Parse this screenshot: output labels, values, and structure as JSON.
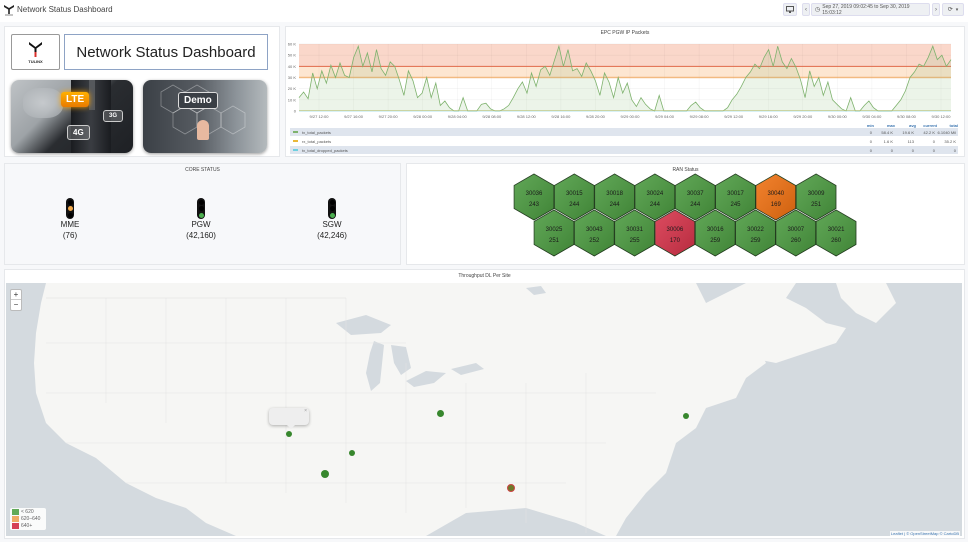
{
  "app": {
    "title": "Network Status Dashboard",
    "logo_icon": "tulinx-logo"
  },
  "toolbar": {
    "tv_mode_icon": "monitor-icon",
    "prev_icon": "chevron-left-icon",
    "time_range": "Sep 27, 2019 09:02:45 to Sep 30, 2019 15:03:12",
    "clock_icon": "clock-icon",
    "next_icon": "chevron-right-icon",
    "refresh_icon": "refresh-icon",
    "dropdown_icon": "caret-down-icon"
  },
  "brand": {
    "logo_text": "TULINX",
    "title": "Network Status Dashboard",
    "promos": [
      {
        "label": "LTE",
        "sublabels": [
          "4G",
          "3G"
        ]
      },
      {
        "label": "Demo"
      }
    ]
  },
  "chart_data": {
    "type": "line",
    "title": "EPC PGW IP Packets",
    "xlabel": "",
    "ylabel": "",
    "ylim": [
      0,
      60000
    ],
    "yticks": [
      "0",
      "10 K",
      "20 K",
      "30 K",
      "40 K",
      "50 K",
      "60 K"
    ],
    "xticks": [
      "9/27 12:00",
      "9/27 16:00",
      "9/27 20:00",
      "9/28 00:00",
      "9/28 04:00",
      "9/28 08:00",
      "9/28 12:00",
      "9/28 16:00",
      "9/28 20:00",
      "9/29 00:00",
      "9/29 04:00",
      "9/29 08:00",
      "9/29 12:00",
      "9/29 16:00",
      "9/29 20:00",
      "9/30 00:00",
      "9/30 04:00",
      "9/30 08:00",
      "9/30 12:00"
    ],
    "thresholds": [
      {
        "value": 30000,
        "color": "#f2a65a",
        "label": "warning"
      },
      {
        "value": 40000,
        "color": "#e0694a",
        "label": "critical"
      }
    ],
    "grid": true,
    "series": [
      {
        "name": "tx_total_packets",
        "color": "#7eb26d",
        "values": [
          12000,
          17000,
          11000,
          34000,
          20000,
          36000,
          25000,
          41000,
          30000,
          43000,
          32000,
          30000,
          48000,
          58000,
          40000,
          52000,
          35000,
          55000,
          38000,
          32000,
          44000,
          40000,
          28000,
          14000,
          36000,
          27000,
          12000,
          16000,
          30000,
          12000,
          25000,
          5000,
          9000,
          3000,
          0,
          0,
          12000,
          0,
          0,
          0,
          6000,
          7000,
          2000,
          0,
          0,
          2000,
          5000,
          12000,
          20000,
          26000,
          16000,
          34000,
          22000,
          37000,
          40000,
          32000,
          45000,
          58000,
          40000,
          55000,
          36000,
          38000,
          31000,
          43000,
          36000,
          27000,
          14000,
          34000,
          26000,
          12000,
          30000,
          16000,
          25000,
          10000,
          4000,
          12000,
          6000,
          2000,
          0,
          14000,
          0,
          0,
          0,
          0,
          0,
          0,
          5000,
          8000,
          3000,
          0,
          0,
          0,
          0,
          0,
          3000,
          10000,
          15000,
          22000,
          30000,
          35000,
          42000,
          38000,
          48000,
          55000,
          40000,
          58000,
          44000,
          38000,
          47000,
          39000,
          28000,
          12000,
          36000,
          22000,
          30000,
          14000,
          26000,
          10000,
          6000,
          2000,
          0,
          12000,
          0,
          0,
          5000,
          9000,
          3000,
          0,
          0,
          0,
          0,
          5000,
          10000,
          18000,
          30000,
          35000,
          42000,
          40000,
          48000,
          58000,
          46000,
          50000,
          40000,
          46000
        ],
        "stats": {
          "min": "0",
          "max": "58.4 K",
          "avg": "19.6 K",
          "current": "42.2 K",
          "total": "6.1040 Mil"
        }
      },
      {
        "name": "rx_total_packets",
        "color": "#eab839",
        "stats": {
          "min": "0",
          "max": "1.6 K",
          "avg": "113",
          "current": "0",
          "total": "35.2 K"
        }
      },
      {
        "name": "tx_total_dropped_packets",
        "color": "#6ed0e0",
        "stats": {
          "min": "0",
          "max": "0",
          "avg": "0",
          "current": "0",
          "total": "0"
        }
      }
    ],
    "legend_columns": [
      "min",
      "max",
      "avg",
      "current",
      "total"
    ],
    "legend_position": "bottom"
  },
  "core_status": {
    "title": "CORE STATUS",
    "nodes": [
      {
        "name": "MME",
        "value": "(76)",
        "status": "warning",
        "color": "#f2a94a"
      },
      {
        "name": "PGW",
        "value": "(42,160)",
        "status": "ok",
        "color": "#4caf50"
      },
      {
        "name": "SGW",
        "value": "(42,246)",
        "status": "ok",
        "color": "#4caf50"
      }
    ]
  },
  "ran_status": {
    "title": "RAN Status",
    "row1": [
      {
        "id": "30036",
        "value": "243",
        "status": "ok"
      },
      {
        "id": "30015",
        "value": "244",
        "status": "ok"
      },
      {
        "id": "30018",
        "value": "244",
        "status": "ok"
      },
      {
        "id": "30024",
        "value": "244",
        "status": "ok"
      },
      {
        "id": "30037",
        "value": "244",
        "status": "ok"
      },
      {
        "id": "30017",
        "value": "245",
        "status": "ok"
      },
      {
        "id": "30040",
        "value": "169",
        "status": "warning"
      },
      {
        "id": "30009",
        "value": "251",
        "status": "ok"
      }
    ],
    "row2": [
      {
        "id": "30025",
        "value": "251",
        "status": "ok"
      },
      {
        "id": "30043",
        "value": "252",
        "status": "ok"
      },
      {
        "id": "30031",
        "value": "255",
        "status": "ok"
      },
      {
        "id": "30006",
        "value": "170",
        "status": "critical"
      },
      {
        "id": "30016",
        "value": "259",
        "status": "ok"
      },
      {
        "id": "30022",
        "value": "259",
        "status": "ok"
      },
      {
        "id": "30007",
        "value": "260",
        "status": "ok"
      },
      {
        "id": "30021",
        "value": "260",
        "status": "ok"
      }
    ],
    "colors": {
      "ok": "#4a9a3f",
      "warning": "#f07010",
      "critical": "#d63249"
    }
  },
  "map": {
    "title": "Throughput DL Per Site",
    "zoom_in": "+",
    "zoom_out": "−",
    "legend": [
      {
        "label": "< 620",
        "color": "#56a64b"
      },
      {
        "label": "620–640",
        "color": "#f2a65a"
      },
      {
        "label": "640+",
        "color": "#d63249"
      }
    ],
    "attribution": "Leaflet | © OpenStreetMap © CartoDB",
    "markers": [
      {
        "site": "san-francisco",
        "color": "#37872d"
      },
      {
        "site": "las-vegas",
        "color": "#37872d"
      },
      {
        "site": "los-angeles",
        "color": "#37872d"
      },
      {
        "site": "denver",
        "color": "#37872d"
      },
      {
        "site": "dallas",
        "color": "#6e7a2a"
      },
      {
        "site": "washington",
        "color": "#37872d"
      }
    ]
  }
}
